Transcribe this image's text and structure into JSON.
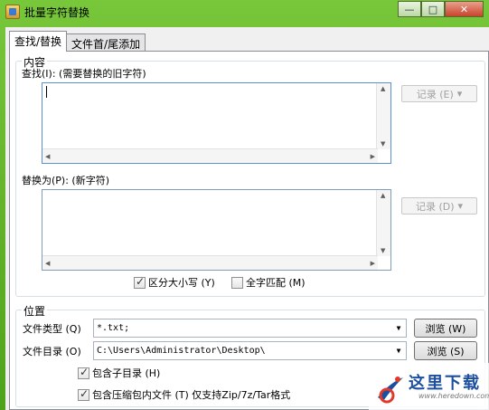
{
  "window": {
    "title": "批量字符替换",
    "controls": {
      "minimize": "—",
      "maximize": "□",
      "close": "✕"
    }
  },
  "tabs": [
    {
      "label": "查找/替换",
      "active": true
    },
    {
      "label": "文件首/尾添加",
      "active": false
    }
  ],
  "content_group": {
    "label": "内容",
    "find_label": "查找(I): (需要替换的旧字符)",
    "find_value": "",
    "find_history_button": "记录 (E)",
    "replace_label": "替换为(P): (新字符)",
    "replace_value": "",
    "replace_history_button": "记录 (D)",
    "case_sensitive": {
      "label": "区分大小写 (Y)",
      "checked": true
    },
    "whole_word": {
      "label": "全字匹配 (M)",
      "checked": false
    }
  },
  "location_group": {
    "label": "位置",
    "file_type_label": "文件类型 (Q)",
    "file_type_value": "*.txt;",
    "browse_type_button": "浏览 (W)",
    "directory_label": "文件目录 (O)",
    "directory_value": "C:\\Users\\Administrator\\Desktop\\",
    "browse_dir_button": "浏览 (S)",
    "include_subdirs": {
      "label": "包含子目录 (H)",
      "checked": true
    },
    "include_archives": {
      "label": "包含压缩包内文件 (T) 仅支持Zip/7z/Tar格式",
      "checked": true
    }
  },
  "watermark": {
    "text": "这里下载",
    "url": "www.heredown.com"
  },
  "colors": {
    "title_bar": "#6fbf2f",
    "close_button": "#c9432c",
    "textarea_focus_border": "#5a8fd4"
  },
  "icons": [
    "app-icon",
    "minimize-icon",
    "maximize-icon",
    "close-icon",
    "dropdown-arrow-icon",
    "scroll-arrow-icon",
    "checkmark-icon",
    "watermark-logo"
  ]
}
